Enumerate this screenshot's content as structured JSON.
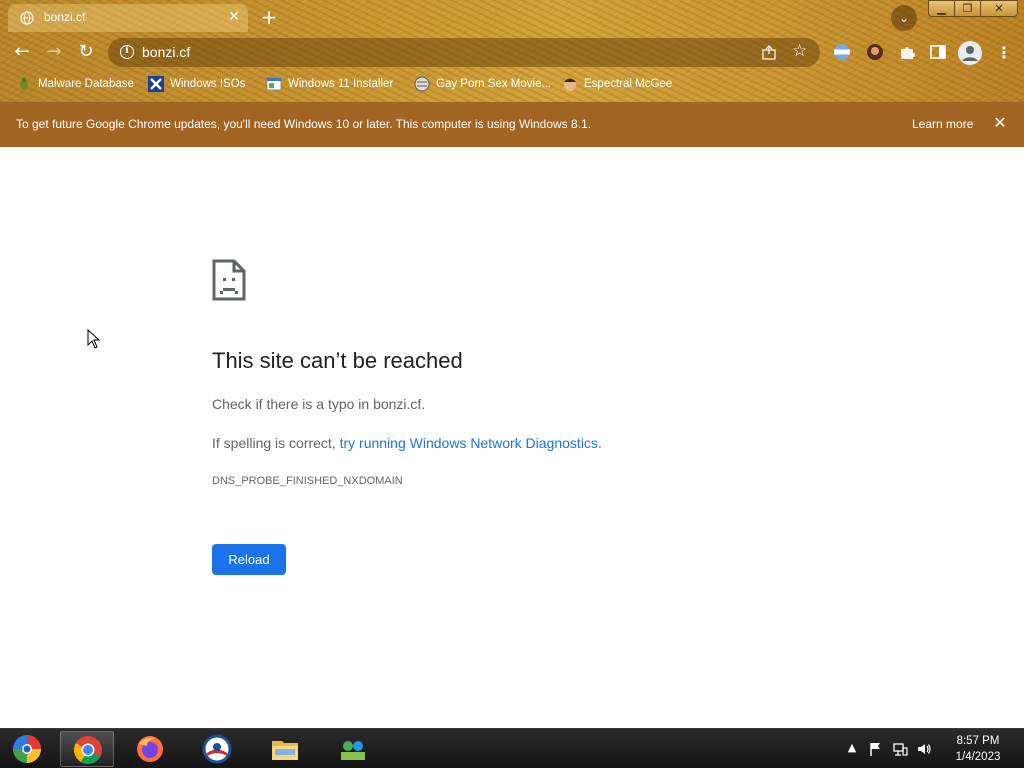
{
  "tab": {
    "title": "bonzi.cf"
  },
  "omnibox": {
    "url": "bonzi.cf"
  },
  "bookmarks": [
    {
      "label": "Malware Database",
      "icon": "bug-icon"
    },
    {
      "label": "Windows ISOs",
      "icon": "x-icon"
    },
    {
      "label": "Windows 11 Installer",
      "icon": "window-icon"
    },
    {
      "label": "Gay Porn Sex Movie...",
      "icon": "globe-icon"
    },
    {
      "label": "Espectral McGee",
      "icon": "face-icon"
    }
  ],
  "infobar": {
    "message": "To get future Google Chrome updates, you'll need Windows 10 or later. This computer is using Windows 8.1.",
    "learn_more": "Learn more"
  },
  "error": {
    "title": "This site can’t be reached",
    "line1": "Check if there is a typo in bonzi.cf.",
    "line2_prefix": "If spelling is correct, ",
    "line2_link": "try running Windows Network Diagnostics",
    "line2_suffix": ".",
    "code": "DNS_PROBE_FINISHED_NXDOMAIN",
    "reload_label": "Reload"
  },
  "taskbar": {
    "items": [
      "windows-logo-icon",
      "chrome-icon",
      "firefox-icon",
      "obama-logo-icon",
      "file-explorer-icon",
      "network-app-icon"
    ],
    "time": "8:57 PM",
    "date": "1/4/2023"
  },
  "colors": {
    "theme_frame": "#c8962f",
    "infobar": "#a36524",
    "link": "#1a73e8",
    "reload_button": "#1a73e8"
  }
}
